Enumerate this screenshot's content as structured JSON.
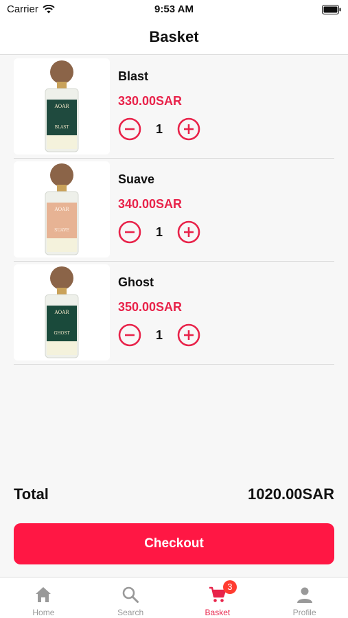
{
  "status_bar": {
    "carrier": "Carrier",
    "time": "9:53 AM"
  },
  "header": {
    "title": "Basket"
  },
  "items": [
    {
      "name": "Blast",
      "price": "330.00SAR",
      "quantity": "1",
      "brand_label": "AOAR",
      "product_label": "BLAST",
      "liquid_color": "#1f4a3e"
    },
    {
      "name": "Suave",
      "price": "340.00SAR",
      "quantity": "1",
      "brand_label": "AOAR",
      "product_label": "SUAVE",
      "liquid_color": "#e7b394"
    },
    {
      "name": "Ghost",
      "price": "350.00SAR",
      "quantity": "1",
      "brand_label": "AOAR",
      "product_label": "GHOST",
      "liquid_color": "#1a4a3b"
    }
  ],
  "summary": {
    "total_label": "Total",
    "total_value": "1020.00SAR"
  },
  "checkout": {
    "label": "Checkout"
  },
  "tabs": [
    {
      "label": "Home",
      "icon": "home-icon"
    },
    {
      "label": "Search",
      "icon": "search-icon"
    },
    {
      "label": "Basket",
      "icon": "cart-icon",
      "badge": "3",
      "active": true
    },
    {
      "label": "Profile",
      "icon": "profile-icon"
    }
  ],
  "colors": {
    "accent": "#ff1744",
    "price": "#e8234a",
    "badge": "#ff3b30",
    "tab_inactive": "#999999"
  }
}
